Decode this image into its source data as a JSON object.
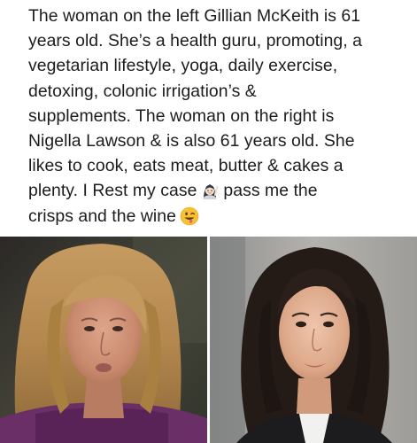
{
  "caption": {
    "lines": [
      "The woman on the left Gillian McKeith is 61",
      "years old. She’s a health guru, promoting, a",
      "vegetarian lifestyle, yoga, daily exercise,",
      "detoxing, colonic irrigation’s &",
      "supplements. The woman on the right is",
      "Nigella Lawson & is also 61 years old. She",
      "likes to cook, eats meat, butter & cakes a",
      "plenty. I Rest my case",
      "pass me the",
      "crisps and the wine"
    ]
  },
  "icons": {
    "line8_emoji": "woman-raising-hand-emoji",
    "line9_emoji": "winking-tongue-out-face-emoji"
  },
  "photos": {
    "left": "woman-with-long-messy-blonde-hair-photo",
    "right": "woman-with-dark-hair-photo"
  },
  "colors": {
    "text": "#1c1c1c",
    "background": "#ffffff"
  }
}
